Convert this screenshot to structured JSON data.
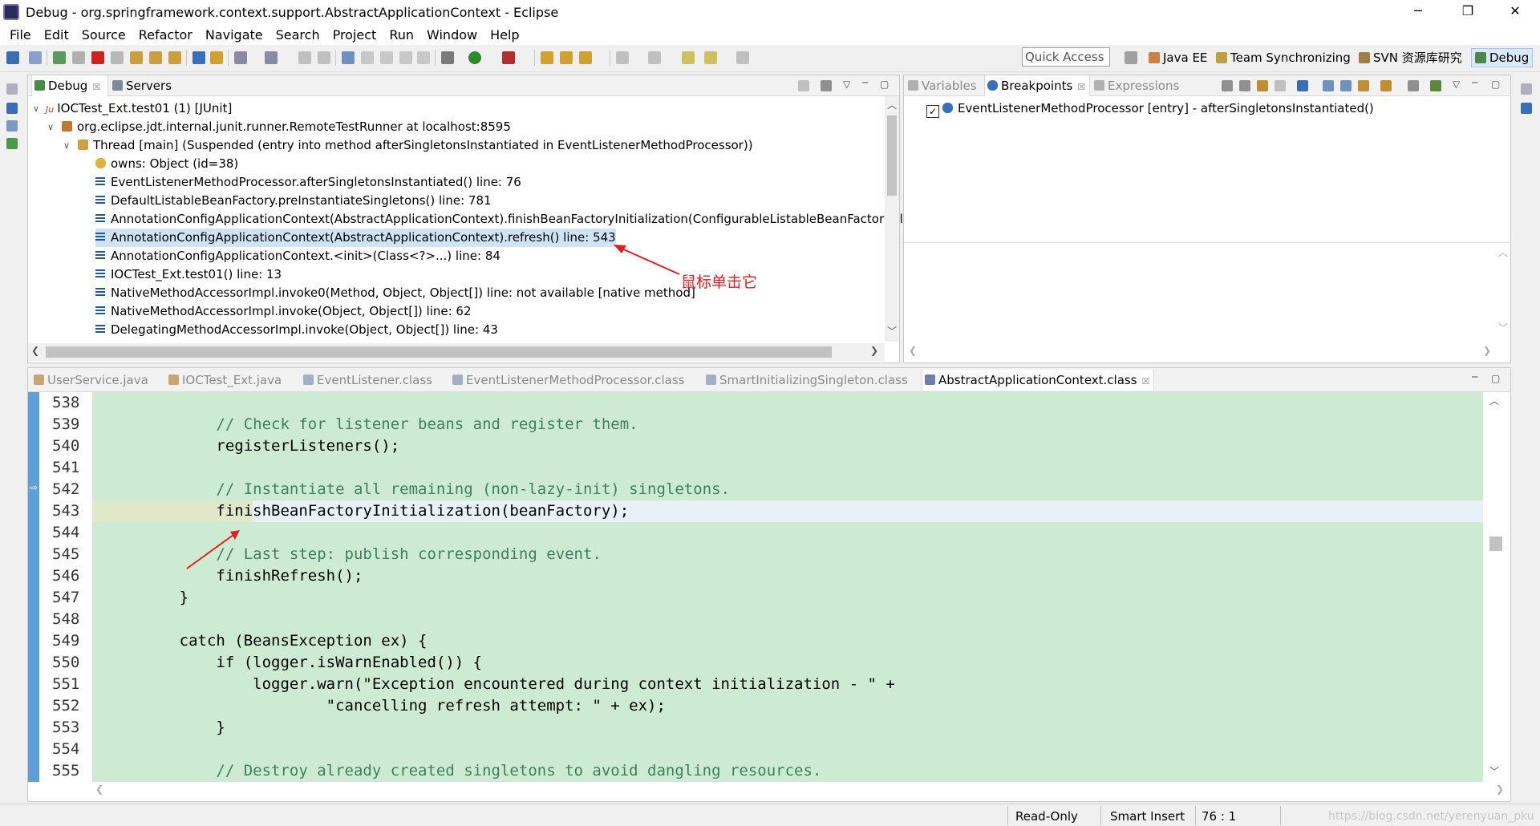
{
  "window": {
    "title": "Debug - org.springframework.context.support.AbstractApplicationContext - Eclipse",
    "minimize": "─",
    "maximize": "❐",
    "close": "✕"
  },
  "menu": [
    "File",
    "Edit",
    "Source",
    "Refactor",
    "Navigate",
    "Search",
    "Project",
    "Run",
    "Window",
    "Help"
  ],
  "quick_access": "Quick Access",
  "perspectives": [
    {
      "label": "Java EE"
    },
    {
      "label": "Team Synchronizing"
    },
    {
      "label": "SVN 资源库研究"
    },
    {
      "label": "Debug",
      "active": true
    }
  ],
  "debug_view": {
    "tabs": [
      {
        "label": "Debug",
        "close": "☒",
        "selected": true
      },
      {
        "label": "Servers"
      }
    ],
    "tree": [
      {
        "text": "IOCTest_Ext.test01 (1) [JUnit]",
        "prefix": "Ju"
      },
      {
        "text": "org.eclipse.jdt.internal.junit.runner.RemoteTestRunner at localhost:8595"
      },
      {
        "text": "Thread [main] (Suspended (entry into method afterSingletonsInstantiated in EventListenerMethodProcessor))"
      },
      {
        "text": "owns: Object  (id=38)"
      },
      {
        "text": "EventListenerMethodProcessor.afterSingletonsInstantiated() line: 76"
      },
      {
        "text": "DefaultListableBeanFactory.preInstantiateSingletons() line: 781"
      },
      {
        "text": "AnnotationConfigApplicationContext(AbstractApplicationContext).finishBeanFactoryInitialization(ConfigurableListableBeanFactory) l"
      },
      {
        "text": "AnnotationConfigApplicationContext(AbstractApplicationContext).refresh() line: 543",
        "selected": true
      },
      {
        "text": "AnnotationConfigApplicationContext.<init>(Class<?>...) line: 84"
      },
      {
        "text": "IOCTest_Ext.test01() line: 13"
      },
      {
        "text": "NativeMethodAccessorImpl.invoke0(Method, Object, Object[]) line: not available [native method]"
      },
      {
        "text": "NativeMethodAccessorImpl.invoke(Object, Object[]) line: 62"
      },
      {
        "text": "DelegatingMethodAccessorImpl.invoke(Object, Object[]) line: 43"
      }
    ],
    "annotation": "鼠标单击它"
  },
  "breakpoints_view": {
    "tabs": [
      {
        "label": "Variables",
        "dim": true
      },
      {
        "label": "Breakpoints",
        "close": "☒",
        "selected": true
      },
      {
        "label": "Expressions",
        "dim": true
      }
    ],
    "items": [
      {
        "text": "EventListenerMethodProcessor [entry] - afterSingletonsInstantiated()",
        "checked": true
      }
    ]
  },
  "editor": {
    "tabs": [
      {
        "label": "UserService.java"
      },
      {
        "label": "IOCTest_Ext.java"
      },
      {
        "label": "EventListener.class"
      },
      {
        "label": "EventListenerMethodProcessor.class"
      },
      {
        "label": "SmartInitializingSingleton.class"
      },
      {
        "label": "AbstractApplicationContext.class",
        "close": "☒",
        "selected": true
      }
    ],
    "lines": [
      {
        "n": "538",
        "code": ""
      },
      {
        "n": "539",
        "code": "          // Check for listener beans and register them."
      },
      {
        "n": "540",
        "code": "          registerListeners();"
      },
      {
        "n": "541",
        "code": ""
      },
      {
        "n": "542",
        "code": "          // Instantiate all remaining (non-lazy-init) singletons."
      },
      {
        "n": "543",
        "code": "          finishBeanFactoryInitialization(beanFactory);"
      },
      {
        "n": "544",
        "code": ""
      },
      {
        "n": "545",
        "code": "          // Last step: publish corresponding event."
      },
      {
        "n": "546",
        "code": "          finishRefresh();"
      },
      {
        "n": "547",
        "code": "      }"
      },
      {
        "n": "548",
        "code": ""
      },
      {
        "n": "549",
        "code": "      catch (BeansException ex) {"
      },
      {
        "n": "550",
        "code": "          if (logger.isWarnEnabled()) {"
      },
      {
        "n": "551",
        "code": "              logger.warn(\"Exception encountered during context initialization - \" +"
      },
      {
        "n": "552",
        "code": "                      \"cancelling refresh attempt: \" + ex);"
      },
      {
        "n": "553",
        "code": "          }"
      },
      {
        "n": "554",
        "code": ""
      },
      {
        "n": "555",
        "code": "          // Destroy already created singletons to avoid dangling resources."
      }
    ]
  },
  "status": {
    "mode": "Read-Only",
    "insert": "Smart Insert",
    "position": "76 : 1",
    "watermark": "https://blog.csdn.net/yerenyuan_pku"
  }
}
